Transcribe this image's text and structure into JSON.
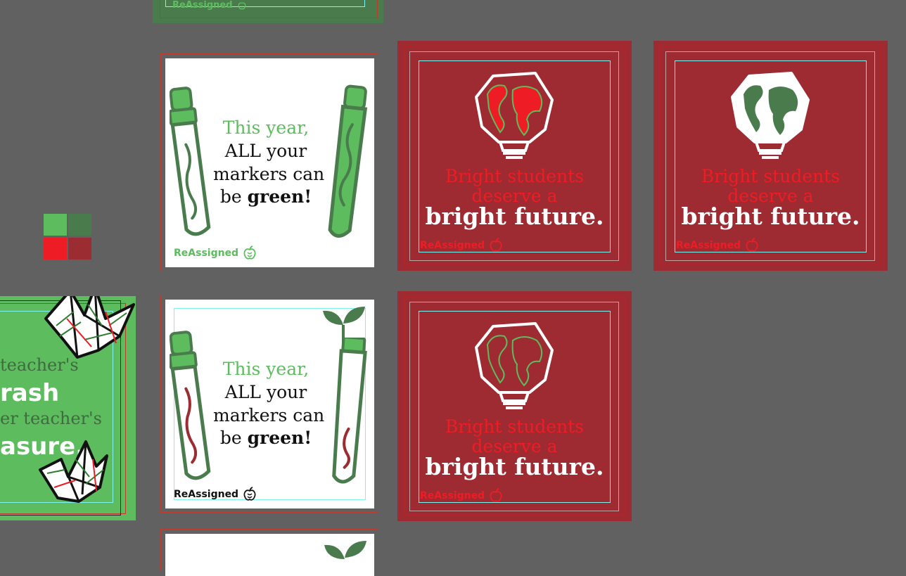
{
  "colors": {
    "canvas": "#616161",
    "light_green": "#5cbc5e",
    "dark_green": "#4a7b4c",
    "bright_red": "#ee1c25",
    "dark_red": "#9b2c31",
    "card_red_bg": "#9e2b31",
    "guide_cyan": "#7ff2f2"
  },
  "brand": {
    "name": "ReAssigned"
  },
  "marker_card": {
    "line1": "This year,",
    "line2": "ALL your",
    "line3": "markers can",
    "line4_pre": "be ",
    "line4_bold": "green!"
  },
  "bright_card": {
    "line1": "Bright students",
    "line2": "deserve a",
    "line3": "bright future."
  },
  "trash_card": {
    "line1": "teacher's",
    "line2": "rash",
    "line3": "er teacher's",
    "line4": "asure."
  },
  "icons": [
    "marker-icon",
    "globe-bulb-icon",
    "apple-logo-icon",
    "paper-crane-icon",
    "sprout-icon"
  ]
}
